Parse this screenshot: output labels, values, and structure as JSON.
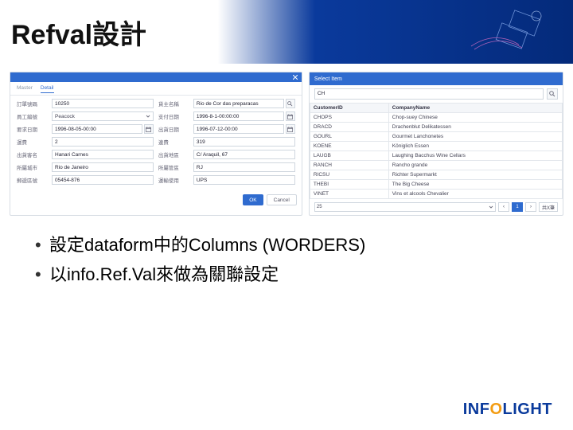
{
  "title": "Refval設計",
  "bullets": [
    "設定dataform中的Columns (WORDERS)",
    "以info.Ref.Val來做為關聯設定"
  ],
  "logo": {
    "p1": "INF",
    "p2": "O",
    "p3": "LIGHT"
  },
  "left_panel": {
    "tabs": [
      "Master",
      "Detail"
    ],
    "active_tab": 1,
    "rows": [
      {
        "l1": "訂單號碼",
        "v1": "10250",
        "l2": "貨主名稱",
        "v2": "Rio de Cor das preparacas",
        "icon2": "search"
      },
      {
        "l1": "員工編號",
        "v1": "Peacock",
        "sel": true,
        "l2": "支付日期",
        "v2": "1996-8-1-00:00:00",
        "icon2": "cal"
      },
      {
        "l1": "要求日期",
        "v1": "1996-08-05-00:00",
        "icon1": "cal",
        "l2": "出貨日期",
        "v2": "1996-07-12-00:00",
        "icon2": "cal"
      },
      {
        "l1": "運費",
        "v1": "2",
        "l2": "連費",
        "v2": "319"
      },
      {
        "l1": "出貨客名",
        "v1": "Hanari Carnes",
        "l2": "出貨地區",
        "v2": "C/ Araquil, 67"
      },
      {
        "l1": "所屬城市",
        "v1": "Rio de Janeiro",
        "l2": "所屬管區",
        "v2": "RJ"
      },
      {
        "l1": "郵遞區號",
        "v1": "05454-876",
        "l2": "運輸使用",
        "v2": "UPS"
      }
    ],
    "ok": "OK",
    "cancel": "Cancel"
  },
  "right_panel": {
    "title": "Select Item",
    "search_value": "CH",
    "columns": [
      "CustomerID",
      "CompanyName"
    ],
    "rows": [
      [
        "CHOPS",
        "Chop-suey Chinese"
      ],
      [
        "DRACD",
        "Drachenblut Delikatessen"
      ],
      [
        "GOURL",
        "Gourmet Lanchonetes"
      ],
      [
        "KOENE",
        "Königlich Essen"
      ],
      [
        "LAUGB",
        "Laughing Bacchus Wine Cellars"
      ],
      [
        "RANCH",
        "Rancho grande"
      ],
      [
        "RICSU",
        "Richter Supermarkt"
      ],
      [
        "THEBI",
        "The Big Cheese"
      ],
      [
        "VINET",
        "Vins et alcools Chevalier"
      ]
    ],
    "pager": {
      "size": "25",
      "prev": "‹",
      "page": "1",
      "next": "›",
      "total": "共X筆"
    }
  }
}
